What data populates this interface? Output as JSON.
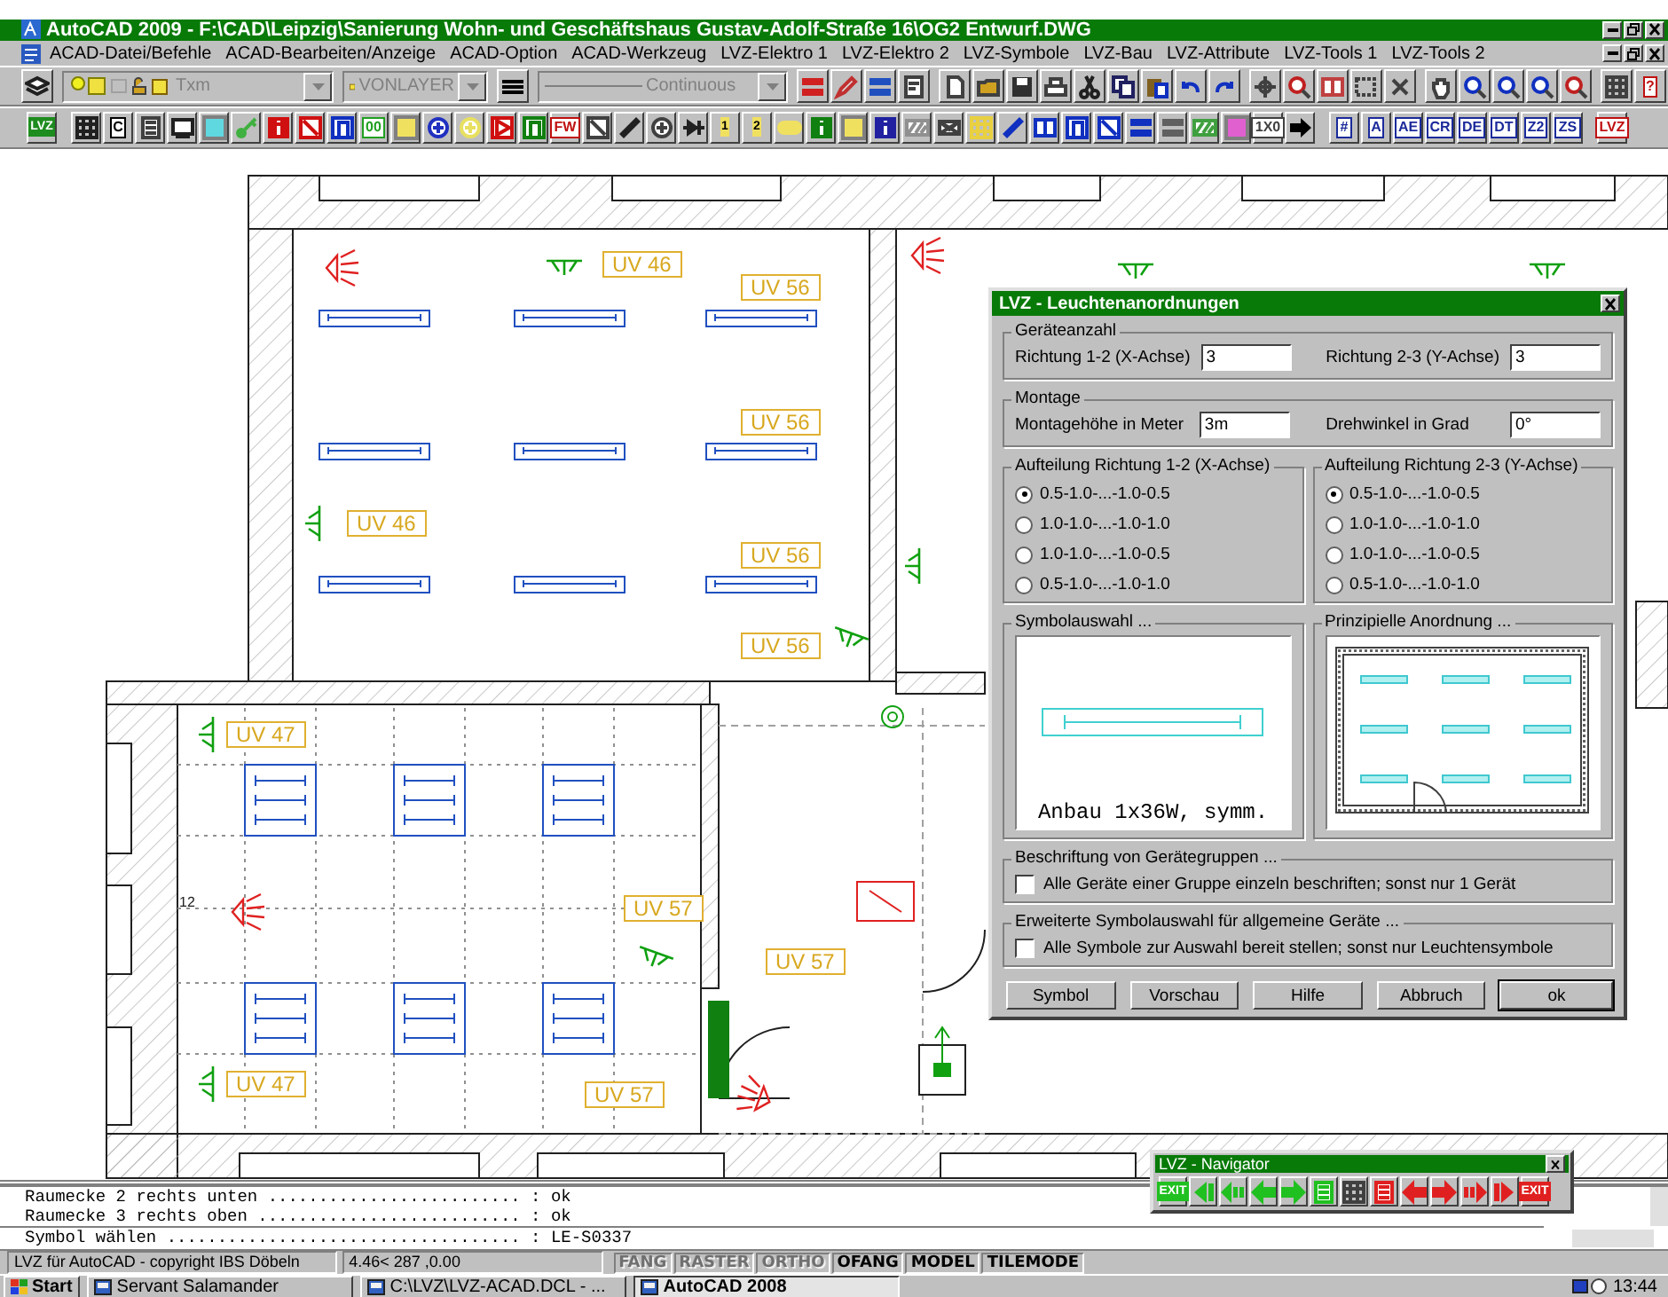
{
  "window": {
    "title": "AutoCAD 2009 -  F:\\CAD\\Leipzig\\Sanierung Wohn- und Geschäftshaus Gustav-Adolf-Straße 16\\OG2 Entwurf.DWG"
  },
  "menu": [
    "ACAD-Datei/Befehle",
    "ACAD-Bearbeiten/Anzeige",
    "ACAD-Option",
    "ACAD-Werkzeug",
    "LVZ-Elektro 1",
    "LVZ-Elektro 2",
    "LVZ-Symbole",
    "LVZ-Bau",
    "LVZ-Attribute",
    "LVZ-Tools 1",
    "LVZ-Tools 2"
  ],
  "toolbar_1": {
    "layer": "Txm",
    "color_control": "VONLAYER",
    "linetype": "Continuous",
    "tools": [
      {
        "kind": "bars",
        "color": "#d02020"
      },
      {
        "kind": "pen",
        "color": "#c03030"
      },
      {
        "kind": "bars",
        "color": "#2050c0"
      },
      {
        "kind": "doc",
        "color": "#404040"
      },
      {
        "kind": "page",
        "color": "#404040"
      },
      {
        "kind": "folder",
        "color": "#d0a020"
      },
      {
        "kind": "floppy",
        "color": "#303030"
      },
      {
        "kind": "printer",
        "color": "#404040"
      },
      {
        "kind": "scissors",
        "color": "#202020"
      },
      {
        "kind": "copy",
        "color": "#202060"
      },
      {
        "kind": "clipboard",
        "color": "#806020"
      },
      {
        "kind": "undo",
        "color": "#1030c0"
      },
      {
        "kind": "redo",
        "color": "#1030c0"
      },
      {
        "kind": "move",
        "color": "#404040"
      },
      {
        "kind": "magnifier",
        "color": "#c02020"
      },
      {
        "kind": "window",
        "color": "#c04040"
      },
      {
        "kind": "frame",
        "color": "#404040"
      },
      {
        "kind": "cursor",
        "color": "#404040"
      },
      {
        "kind": "hand",
        "color": "#404040"
      },
      {
        "kind": "magnifier",
        "color": "#1030c0"
      },
      {
        "kind": "magnifier",
        "color": "#1030c0"
      },
      {
        "kind": "magnifier",
        "color": "#1030c0"
      },
      {
        "kind": "magnifier",
        "color": "#c02020"
      },
      {
        "kind": "grid",
        "color": "#404040"
      },
      {
        "kind": "text",
        "label": "?",
        "color": "#c01010"
      }
    ]
  },
  "toolbar_2": [
    {
      "kind": "badge",
      "label": "LVZ",
      "color": "#1e8c1e"
    },
    {
      "kind": "grid",
      "color": "#202020"
    },
    {
      "kind": "text",
      "label": "C",
      "color": "#000000"
    },
    {
      "kind": "lines",
      "color": "#404040"
    },
    {
      "kind": "screen",
      "color": "#202020"
    },
    {
      "kind": "fill",
      "color": "#60d8e0"
    },
    {
      "kind": "key",
      "color": "#40b040"
    },
    {
      "kind": "figure",
      "color": "#d01010"
    },
    {
      "kind": "cross",
      "color": "#d01010"
    },
    {
      "kind": "door",
      "color": "#1030c0"
    },
    {
      "kind": "text",
      "label": "00",
      "color": "#20a020"
    },
    {
      "kind": "fill",
      "color": "#f0e060"
    },
    {
      "kind": "circle",
      "color": "#2030c0"
    },
    {
      "kind": "circle",
      "color": "#e8e060"
    },
    {
      "kind": "play",
      "color": "#d01010"
    },
    {
      "kind": "door",
      "color": "#108010"
    },
    {
      "kind": "text",
      "label": "FW",
      "color": "#c01010"
    },
    {
      "kind": "cross",
      "color": "#404040"
    },
    {
      "kind": "line",
      "color": "#202020"
    },
    {
      "kind": "circle",
      "color": "#404040"
    },
    {
      "kind": "diode",
      "color": "#202020"
    },
    {
      "kind": "badge",
      "label": "1",
      "color": "#f0e060"
    },
    {
      "kind": "badge",
      "label": "2",
      "color": "#f0e060"
    },
    {
      "kind": "pill",
      "color": "#f0e060"
    },
    {
      "kind": "figure",
      "color": "#108010"
    },
    {
      "kind": "fill",
      "color": "#f0e060"
    },
    {
      "kind": "figure",
      "color": "#2020a0"
    },
    {
      "kind": "hatch",
      "color": "#909090"
    },
    {
      "kind": "envelope",
      "color": "#404040"
    },
    {
      "kind": "grid",
      "color": "#e8d040"
    },
    {
      "kind": "line",
      "color": "#1030c0"
    },
    {
      "kind": "window",
      "color": "#1030c0"
    },
    {
      "kind": "door",
      "color": "#1030c0"
    },
    {
      "kind": "cross",
      "color": "#1030c0"
    },
    {
      "kind": "bars",
      "color": "#1030c0"
    },
    {
      "kind": "bars",
      "color": "#606060"
    },
    {
      "kind": "hatch",
      "color": "#40a040"
    },
    {
      "kind": "fill",
      "color": "#e060d0"
    },
    {
      "kind": "text",
      "label": "1X0",
      "color": "#404040"
    },
    {
      "kind": "arrow",
      "color": "#000000"
    },
    {
      "kind": "text",
      "label": "#",
      "color": "#1a2a9a"
    },
    {
      "kind": "text",
      "label": "A",
      "color": "#1a2a9a"
    },
    {
      "kind": "text",
      "label": "AE",
      "color": "#1a2a9a"
    },
    {
      "kind": "text",
      "label": "CR",
      "color": "#1a2a9a"
    },
    {
      "kind": "text",
      "label": "DE",
      "color": "#1a2a9a"
    },
    {
      "kind": "text",
      "label": "DT",
      "color": "#1a2a9a"
    },
    {
      "kind": "text",
      "label": "Z2",
      "color": "#1a2a9a"
    },
    {
      "kind": "text",
      "label": "ZS",
      "color": "#1a2a9a"
    },
    {
      "kind": "text",
      "label": "LVZ",
      "color": "#c01010"
    }
  ],
  "drawing": {
    "labels": [
      {
        "text": "UV 46",
        "kind": "boxed"
      },
      {
        "text": "UV 56",
        "kind": "boxed"
      },
      {
        "text": "UV 56",
        "kind": "boxed"
      },
      {
        "text": "UV 46",
        "kind": "boxed"
      },
      {
        "text": "UV 56",
        "kind": "boxed"
      },
      {
        "text": "UV 56",
        "kind": "boxed"
      },
      {
        "text": "UV 47",
        "kind": "boxed"
      },
      {
        "text": "12",
        "kind": "plain"
      },
      {
        "text": "UV 57",
        "kind": "boxed"
      },
      {
        "text": "UV 57",
        "kind": "boxed"
      },
      {
        "text": "UV 47",
        "kind": "boxed"
      },
      {
        "text": "UV 57",
        "kind": "boxed"
      }
    ]
  },
  "dialog": {
    "title": "LVZ - Leuchtenanordnungen",
    "count": {
      "title": "Geräteanzahl",
      "fields": [
        {
          "label": "Richtung 1-2 (X-Achse)",
          "value": "3"
        },
        {
          "label": "Richtung 2-3 (Y-Achse)",
          "value": "3"
        }
      ]
    },
    "mounting": {
      "title": "Montage",
      "fields": [
        {
          "label": "Montagehöhe in Meter",
          "value": "3m"
        },
        {
          "label": "Drehwinkel in Grad",
          "value": "0°"
        }
      ]
    },
    "splits": [
      {
        "title": "Aufteilung Richtung 1-2 (X-Achse)",
        "options": [
          {
            "label": "0.5-1.0-...-1.0-0.5",
            "selected": true
          },
          {
            "label": "1.0-1.0-...-1.0-1.0",
            "selected": false
          },
          {
            "label": "1.0-1.0-...-1.0-0.5",
            "selected": false
          },
          {
            "label": "0.5-1.0-...-1.0-1.0",
            "selected": false
          }
        ]
      },
      {
        "title": "Aufteilung Richtung 2-3 (Y-Achse)",
        "options": [
          {
            "label": "0.5-1.0-...-1.0-0.5",
            "selected": true
          },
          {
            "label": "1.0-1.0-...-1.0-1.0",
            "selected": false
          },
          {
            "label": "1.0-1.0-...-1.0-0.5",
            "selected": false
          },
          {
            "label": "0.5-1.0-...-1.0-1.0",
            "selected": false
          }
        ]
      }
    ],
    "symbol": {
      "title": "Symbolauswahl ...",
      "caption": "Anbau 1x36W, symm."
    },
    "arrangement": {
      "title": "Prinzipielle Anordnung ..."
    },
    "options": [
      {
        "title": "Beschriftung von Gerätegruppen ...",
        "label": "Alle Geräte einer Gruppe einzeln beschriften; sonst nur 1 Gerät",
        "checked": false
      },
      {
        "title": "Erweiterte Symbolauswahl für allgemeine Geräte ...",
        "label": "Alle Symbole zur Auswahl bereit stellen; sonst nur Leuchtensymbole",
        "checked": false
      }
    ],
    "buttons": [
      {
        "label": "Symbol",
        "default": false
      },
      {
        "label": "Vorschau",
        "default": false
      },
      {
        "label": "Hilfe",
        "default": false
      },
      {
        "label": "Abbruch",
        "default": false
      },
      {
        "label": "ok",
        "default": true
      }
    ]
  },
  "navigator": {
    "title": "LVZ - Navigator",
    "buttons": [
      {
        "kind": "badge",
        "label": "EXIT",
        "color": "#20c020"
      },
      {
        "kind": "left-bar",
        "color": "#20c020"
      },
      {
        "kind": "left-double",
        "color": "#20c020"
      },
      {
        "kind": "left",
        "color": "#20c020"
      },
      {
        "kind": "right",
        "color": "#20c020"
      },
      {
        "kind": "lines",
        "color": "#20c020"
      },
      {
        "kind": "grid",
        "color": "#404040"
      },
      {
        "kind": "lines",
        "color": "#e02020"
      },
      {
        "kind": "left",
        "color": "#e02020"
      },
      {
        "kind": "right",
        "color": "#e02020"
      },
      {
        "kind": "right-double",
        "color": "#e02020"
      },
      {
        "kind": "right-bar",
        "color": "#e02020"
      },
      {
        "kind": "badge",
        "label": "EXIT",
        "color": "#e02020"
      }
    ]
  },
  "command_lines": [
    "Raumecke 2 rechts unten ......................... : ok",
    "Raumecke 3 rechts oben .......................... : ok"
  ],
  "command_prompt": "Symbol wählen ................................... : LE-S0337",
  "status_bar": {
    "text": "LVZ für AutoCAD - copyright IBS Döbeln",
    "coordinates": "4.46<  287 ,0.00",
    "toggles": [
      {
        "label": "FANG",
        "on": false
      },
      {
        "label": "RASTER",
        "on": false
      },
      {
        "label": "ORTHO",
        "on": false
      },
      {
        "label": "OFANG",
        "on": true
      },
      {
        "label": "MODEL",
        "on": true
      },
      {
        "label": "TILEMODE",
        "on": true
      }
    ]
  },
  "taskbar": {
    "start": "Start",
    "tasks": [
      {
        "label": "Servant Salamander",
        "selected": false
      },
      {
        "label": "C:\\LVZ\\LVZ-ACAD.DCL - ...",
        "selected": false
      },
      {
        "label": "AutoCAD 2008",
        "selected": true
      }
    ],
    "clock": "13:44"
  }
}
